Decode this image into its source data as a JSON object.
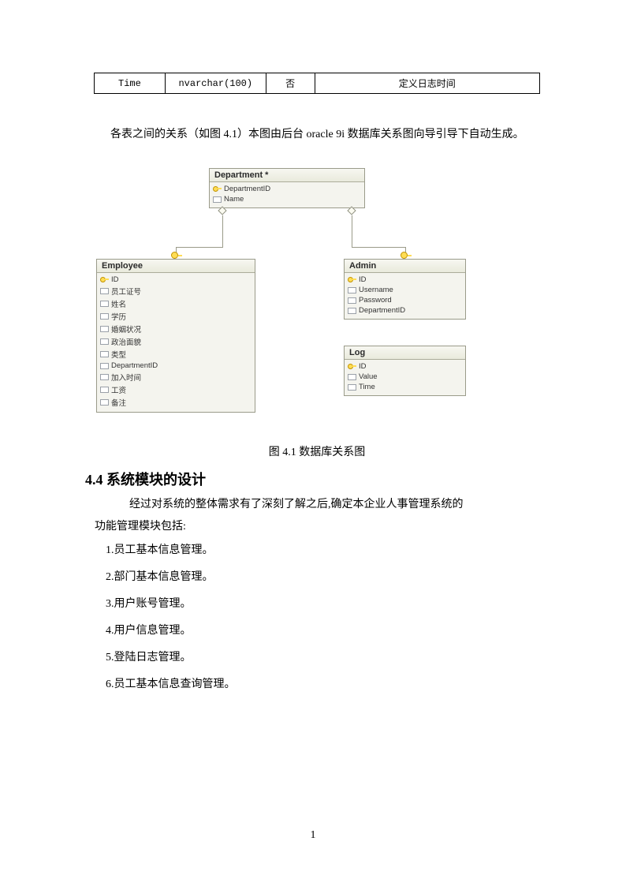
{
  "top_row": {
    "c1": "Time",
    "c2": "nvarchar(100)",
    "c3": "否",
    "c4": "定义日志时间"
  },
  "intro": "各表之间的关系（如图 4.1）本图由后台 oracle 9i 数据库关系图向导引导下自动生成。",
  "er": {
    "department": {
      "title": "Department *",
      "fields": [
        "DepartmentID",
        "Name"
      ]
    },
    "employee": {
      "title": "Employee",
      "fields": [
        "ID",
        "员工证号",
        "姓名",
        "学历",
        "婚姻状况",
        "政治面貌",
        "类型",
        "DepartmentID",
        "加入时间",
        "工资",
        "备注"
      ]
    },
    "admin": {
      "title": "Admin",
      "fields": [
        "ID",
        "Username",
        "Password",
        "DepartmentID"
      ]
    },
    "log": {
      "title": "Log",
      "fields": [
        "ID",
        "Value",
        "Time"
      ]
    }
  },
  "caption": "图 4.1 数据库关系图",
  "section_heading": "4.4 系统模块的设计",
  "section_intro": "经过对系统的整体需求有了深刻了解之后,确定本企业人事管理系统的",
  "section_sub": "功能管理模块包括:",
  "items": [
    "1.员工基本信息管理。",
    "2.部门基本信息管理。",
    "3.用户账号管理。",
    "4.用户信息管理。",
    "5.登陆日志管理。",
    "6.员工基本信息查询管理。"
  ],
  "page_number": "1"
}
